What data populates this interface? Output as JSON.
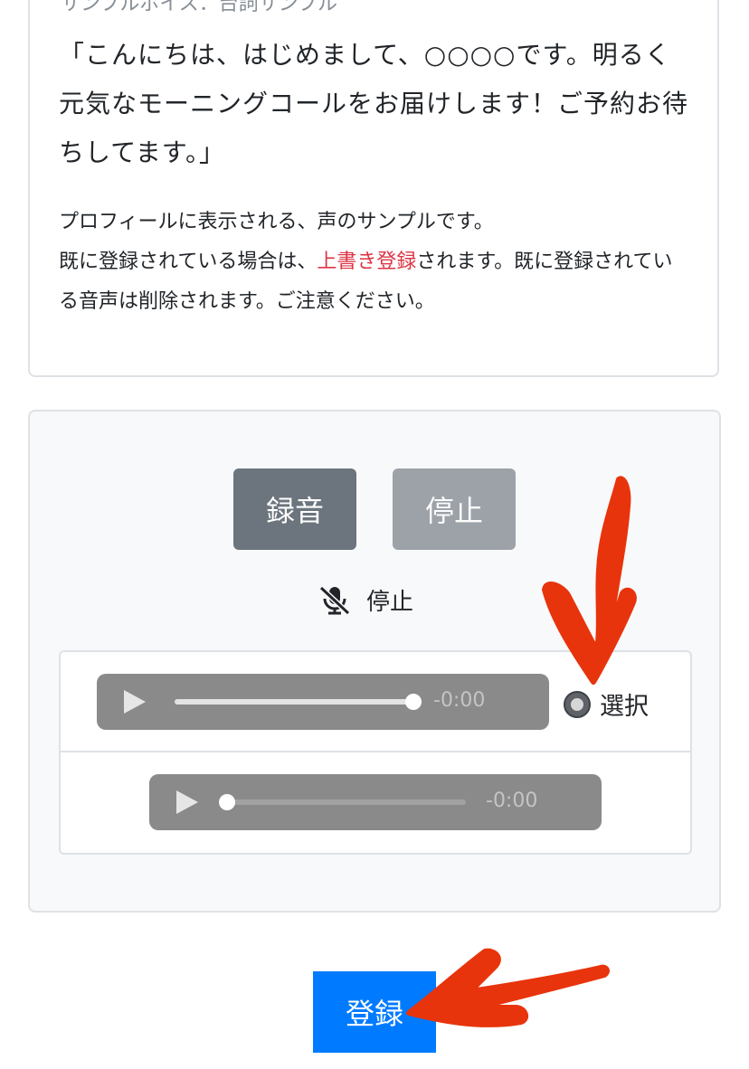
{
  "sample": {
    "header": "サンプルボイス：台詞サンプル",
    "quote": "「こんにちは、はじめまして、○○○○です。明るく元気なモーニングコールをお届けします！ご予約お待ちしてます。」",
    "note_line1": "プロフィールに表示される、声のサンプルです。",
    "note_pre": "既に登録されている場合は、",
    "note_highlight": "上書き登録",
    "note_post": "されます。既に登録されている音声は削除されます。ご注意ください。"
  },
  "recorder": {
    "record_label": "録音",
    "stop_label": "停止",
    "status_icon": "mic-off-icon",
    "status_text": "停止"
  },
  "recordings": [
    {
      "time": "-0:00",
      "progress": 1.0,
      "select_label": "選択",
      "selected": true
    },
    {
      "time": "-0:00",
      "progress": 0.0
    }
  ],
  "submit_label": "登録",
  "colors": {
    "record_button": "#6c757d",
    "submit_button": "#007bff",
    "highlight": "#dc3545",
    "annotation_arrow": "#e8340c"
  }
}
